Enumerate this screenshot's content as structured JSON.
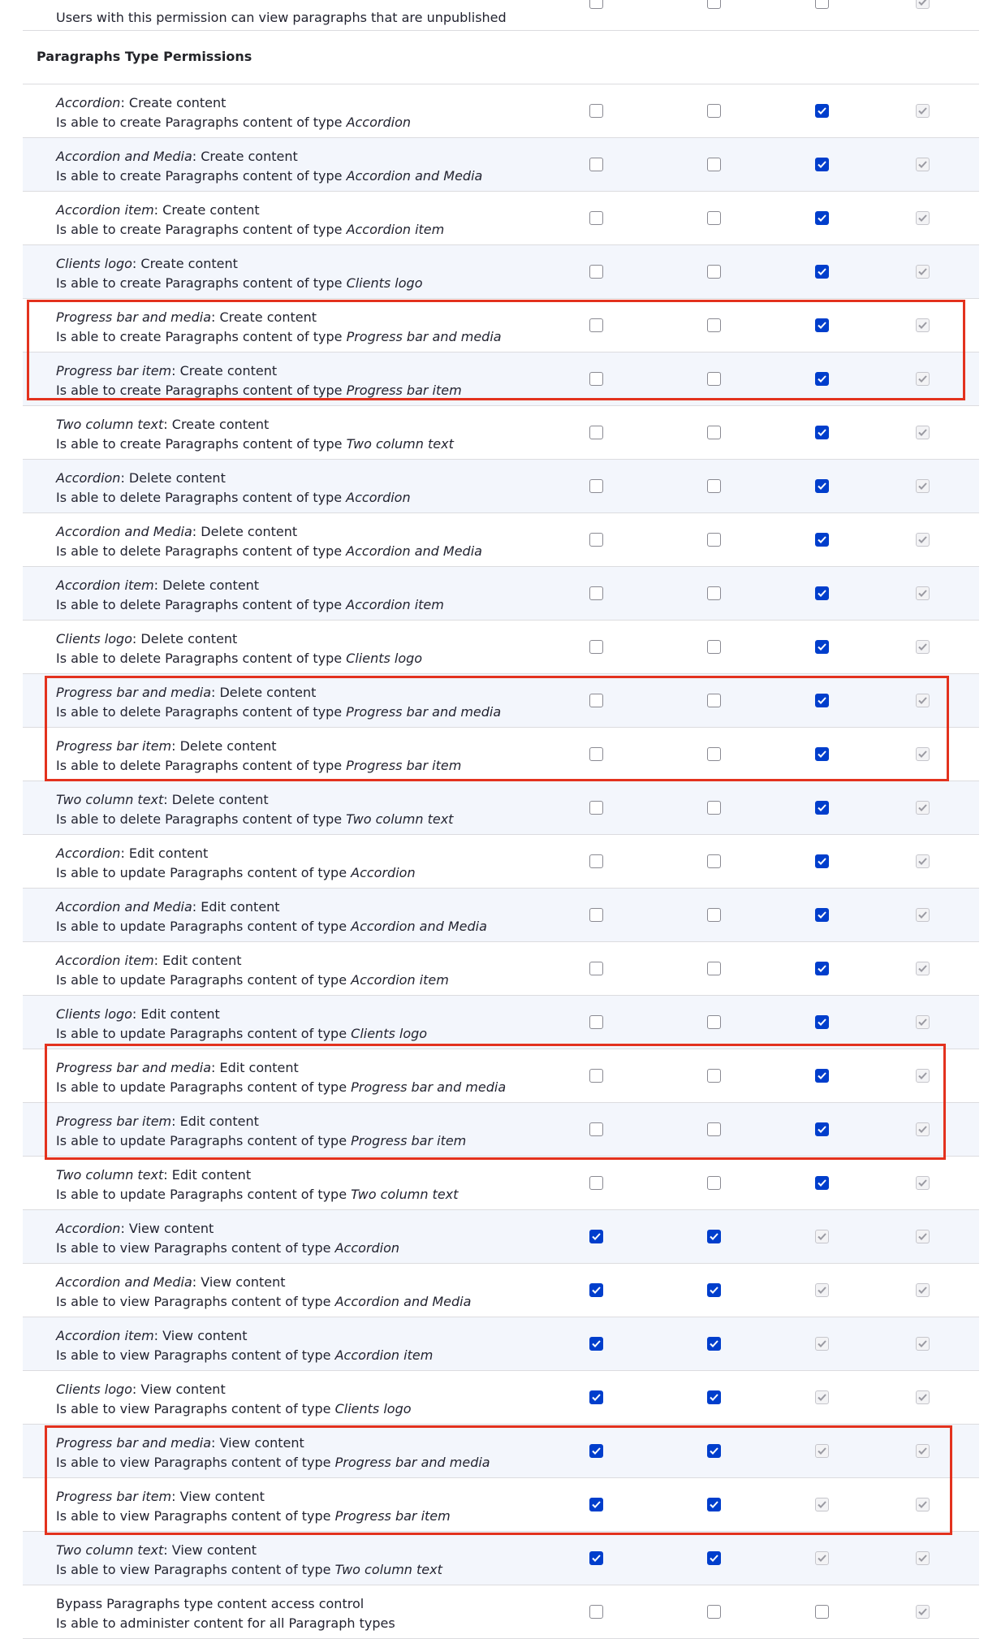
{
  "top_row": {
    "desc": "Users with this permission can view paragraphs that are unpublished",
    "checks": [
      "off",
      "off",
      "off",
      "dis"
    ]
  },
  "section_title": "Paragraphs Type Permissions",
  "rows": [
    {
      "type": "Accordion",
      "action": "Create content",
      "verb": "create",
      "checks": [
        "off",
        "off",
        "on",
        "dis"
      ]
    },
    {
      "type": "Accordion and Media",
      "action": "Create content",
      "verb": "create",
      "checks": [
        "off",
        "off",
        "on",
        "dis"
      ]
    },
    {
      "type": "Accordion item",
      "action": "Create content",
      "verb": "create",
      "checks": [
        "off",
        "off",
        "on",
        "dis"
      ]
    },
    {
      "type": "Clients logo",
      "action": "Create content",
      "verb": "create",
      "checks": [
        "off",
        "off",
        "on",
        "dis"
      ]
    },
    {
      "type": "Progress bar and media",
      "action": "Create content",
      "verb": "create",
      "checks": [
        "off",
        "off",
        "on",
        "dis"
      ]
    },
    {
      "type": "Progress bar item",
      "action": "Create content",
      "verb": "create",
      "checks": [
        "off",
        "off",
        "on",
        "dis"
      ]
    },
    {
      "type": "Two column text",
      "action": "Create content",
      "verb": "create",
      "checks": [
        "off",
        "off",
        "on",
        "dis"
      ]
    },
    {
      "type": "Accordion",
      "action": "Delete content",
      "verb": "delete",
      "checks": [
        "off",
        "off",
        "on",
        "dis"
      ]
    },
    {
      "type": "Accordion and Media",
      "action": "Delete content",
      "verb": "delete",
      "checks": [
        "off",
        "off",
        "on",
        "dis"
      ]
    },
    {
      "type": "Accordion item",
      "action": "Delete content",
      "verb": "delete",
      "checks": [
        "off",
        "off",
        "on",
        "dis"
      ]
    },
    {
      "type": "Clients logo",
      "action": "Delete content",
      "verb": "delete",
      "checks": [
        "off",
        "off",
        "on",
        "dis"
      ]
    },
    {
      "type": "Progress bar and media",
      "action": "Delete content",
      "verb": "delete",
      "checks": [
        "off",
        "off",
        "on",
        "dis"
      ]
    },
    {
      "type": "Progress bar item",
      "action": "Delete content",
      "verb": "delete",
      "checks": [
        "off",
        "off",
        "on",
        "dis"
      ]
    },
    {
      "type": "Two column text",
      "action": "Delete content",
      "verb": "delete",
      "checks": [
        "off",
        "off",
        "on",
        "dis"
      ]
    },
    {
      "type": "Accordion",
      "action": "Edit content",
      "verb": "update",
      "checks": [
        "off",
        "off",
        "on",
        "dis"
      ]
    },
    {
      "type": "Accordion and Media",
      "action": "Edit content",
      "verb": "update",
      "checks": [
        "off",
        "off",
        "on",
        "dis"
      ]
    },
    {
      "type": "Accordion item",
      "action": "Edit content",
      "verb": "update",
      "checks": [
        "off",
        "off",
        "on",
        "dis"
      ]
    },
    {
      "type": "Clients logo",
      "action": "Edit content",
      "verb": "update",
      "checks": [
        "off",
        "off",
        "on",
        "dis"
      ]
    },
    {
      "type": "Progress bar and media",
      "action": "Edit content",
      "verb": "update",
      "checks": [
        "off",
        "off",
        "on",
        "dis"
      ]
    },
    {
      "type": "Progress bar item",
      "action": "Edit content",
      "verb": "update",
      "checks": [
        "off",
        "off",
        "on",
        "dis"
      ]
    },
    {
      "type": "Two column text",
      "action": "Edit content",
      "verb": "update",
      "checks": [
        "off",
        "off",
        "on",
        "dis"
      ]
    },
    {
      "type": "Accordion",
      "action": "View content",
      "verb": "view",
      "checks": [
        "on",
        "on",
        "dis",
        "dis"
      ]
    },
    {
      "type": "Accordion and Media",
      "action": "View content",
      "verb": "view",
      "checks": [
        "on",
        "on",
        "dis",
        "dis"
      ]
    },
    {
      "type": "Accordion item",
      "action": "View content",
      "verb": "view",
      "checks": [
        "on",
        "on",
        "dis",
        "dis"
      ]
    },
    {
      "type": "Clients logo",
      "action": "View content",
      "verb": "view",
      "checks": [
        "on",
        "on",
        "dis",
        "dis"
      ]
    },
    {
      "type": "Progress bar and media",
      "action": "View content",
      "verb": "view",
      "checks": [
        "on",
        "on",
        "dis",
        "dis"
      ]
    },
    {
      "type": "Progress bar item",
      "action": "View content",
      "verb": "view",
      "checks": [
        "on",
        "on",
        "dis",
        "dis"
      ]
    },
    {
      "type": "Two column text",
      "action": "View content",
      "verb": "view",
      "checks": [
        "on",
        "on",
        "dis",
        "dis"
      ]
    }
  ],
  "bypass_row": {
    "title": "Bypass Paragraphs type content access control",
    "desc": "Is able to administer content for all Paragraph types",
    "checks": [
      "off",
      "off",
      "off",
      "dis"
    ]
  },
  "strings": {
    "desc_prefix": "Is able to ",
    "desc_middle": " Paragraphs content of type "
  },
  "colors": {
    "checked": "#003ecc",
    "highlight": "#e3321e",
    "alt_row": "#f3f6fc"
  }
}
